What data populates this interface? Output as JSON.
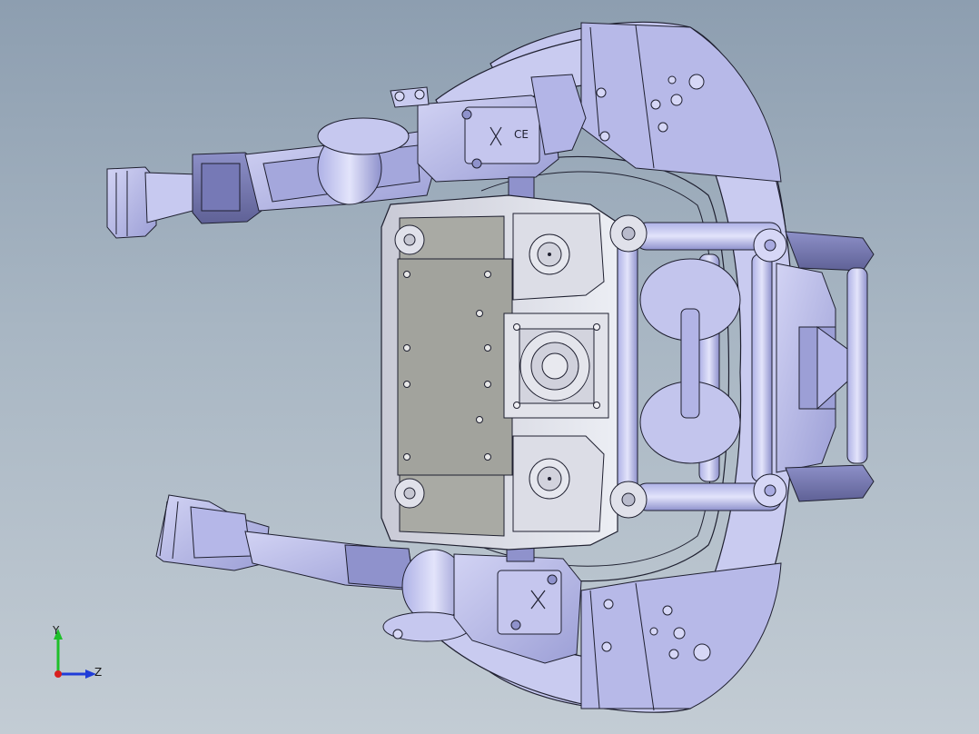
{
  "viewport": {
    "background_top": "#8d9eb0",
    "background_bottom": "#c3ccd4"
  },
  "model": {
    "part_color": "#b9bbe8",
    "part_shade": "#8f92cc",
    "part_dark": "#5f6196",
    "panel_color": "#a9aaa4",
    "bracket_color": "#d8d9e3",
    "edge_color": "#1f2030",
    "marks": {
      "ce": "CE"
    }
  },
  "triad": {
    "y_label": "Y",
    "z_label": "Z",
    "y_color": "#1fbf2a",
    "z_color": "#1f3cd8",
    "x_color": "#d81f1f"
  }
}
